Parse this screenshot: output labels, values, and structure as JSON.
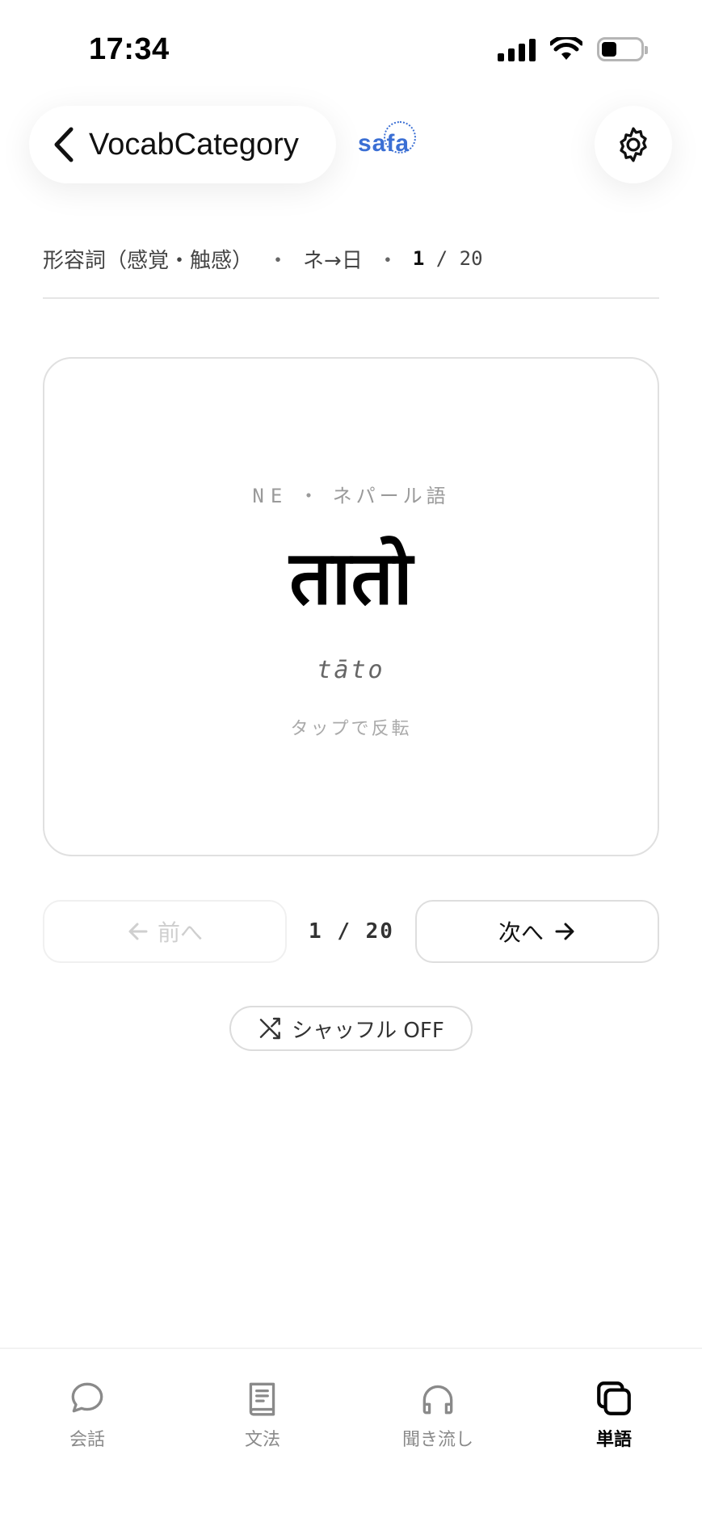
{
  "status_bar": {
    "time": "17:34"
  },
  "header": {
    "back_label": "VocabCategory",
    "logo_text": "safa"
  },
  "breadcrumb": {
    "category": "形容詞（感覚・触感）",
    "direction": "ネ→日",
    "separator": "・",
    "current": "1",
    "total": "/ 20"
  },
  "card": {
    "lang_code": "NE",
    "lang_separator": "・",
    "lang_name": "ネパール語",
    "word": "तातो",
    "romanization": "tāto",
    "hint": "タップで反転"
  },
  "nav": {
    "prev_label": "前へ",
    "counter": "1 / 20",
    "next_label": "次へ",
    "shuffle_label": "シャッフル OFF"
  },
  "tabs": [
    {
      "label": "会話",
      "icon": "chat-bubble-icon",
      "active": false
    },
    {
      "label": "文法",
      "icon": "book-icon",
      "active": false
    },
    {
      "label": "聞き流し",
      "icon": "headphones-icon",
      "active": false
    },
    {
      "label": "単語",
      "icon": "cards-icon",
      "active": true
    }
  ],
  "colors": {
    "accent": "#3b6fd4",
    "text": "#1a1a1a",
    "muted": "#9a9a9a"
  }
}
